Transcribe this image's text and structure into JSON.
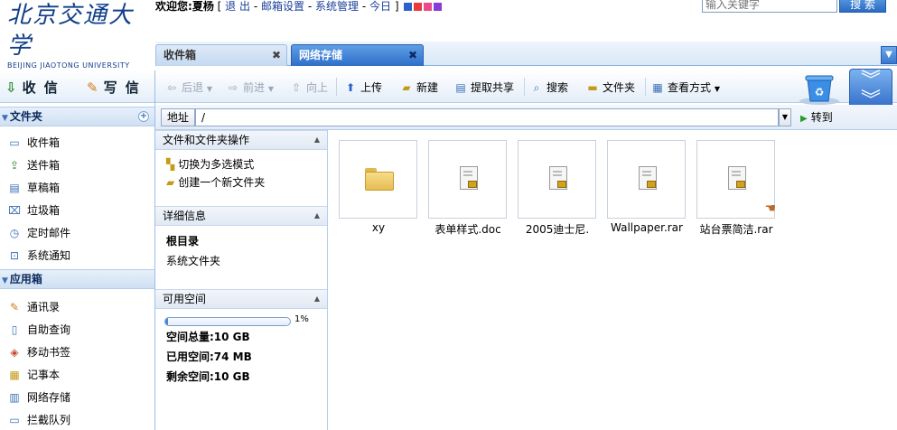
{
  "header": {
    "logo_cn": "北京交通大学",
    "logo_en": "BEIJING JIAOTONG UNIVERSITY",
    "welcome_label": "欢迎您:",
    "user_name": "夏杨",
    "links": [
      "退 出",
      "邮箱设置",
      "系统管理",
      "今日"
    ],
    "bracket_open": "[",
    "bracket_close": "]",
    "separator": "-",
    "swatch_colors": [
      "#2a62c9",
      "#e83a3a",
      "#e84a8a",
      "#8a3ad6"
    ],
    "search_placeholder": "输入关键字",
    "search_button": "搜 索"
  },
  "tabs": [
    {
      "label": "收件箱",
      "close": "✖"
    },
    {
      "label": "网络存储",
      "close": "✖"
    }
  ],
  "sidebar": {
    "receive_label": "收 信",
    "write_label": "写 信",
    "folder_section": "文件夹",
    "folders": [
      "收件箱",
      "送件箱",
      "草稿箱",
      "垃圾箱",
      "定时邮件",
      "系统通知"
    ],
    "apps_section": "应用箱",
    "apps": [
      "通讯录",
      "自助查询",
      "移动书签",
      "记事本",
      "网络存储",
      "拦截队列"
    ]
  },
  "toolbar": {
    "back": "后退",
    "forward": "前进",
    "up": "向上",
    "upload": "上传",
    "new": "新建",
    "share": "提取共享",
    "search": "搜索",
    "folder": "文件夹",
    "view": "查看方式"
  },
  "address": {
    "label": "地址",
    "value": "/",
    "goto": "转到"
  },
  "panel": {
    "ops_title": "文件和文件夹操作",
    "op_multiselect": "切换为多选模式",
    "op_newfolder": "创建一个新文件夹",
    "detail_title": "详细信息",
    "detail_name": "根目录",
    "detail_type": "系统文件夹",
    "space_title": "可用空间",
    "space_percent": "1%",
    "space_fill_fraction": 0.01,
    "space_total": "空间总量:10 GB",
    "space_used": "已用空间:74 MB",
    "space_free": "剩余空间:10 GB"
  },
  "files": [
    {
      "name": "xy",
      "kind": "folder"
    },
    {
      "name": "表单样式.doc",
      "kind": "file"
    },
    {
      "name": "2005迪士尼.",
      "kind": "file"
    },
    {
      "name": "Wallpaper.rar",
      "kind": "file"
    },
    {
      "name": "站台票简洁.rar",
      "kind": "file-shared"
    }
  ]
}
